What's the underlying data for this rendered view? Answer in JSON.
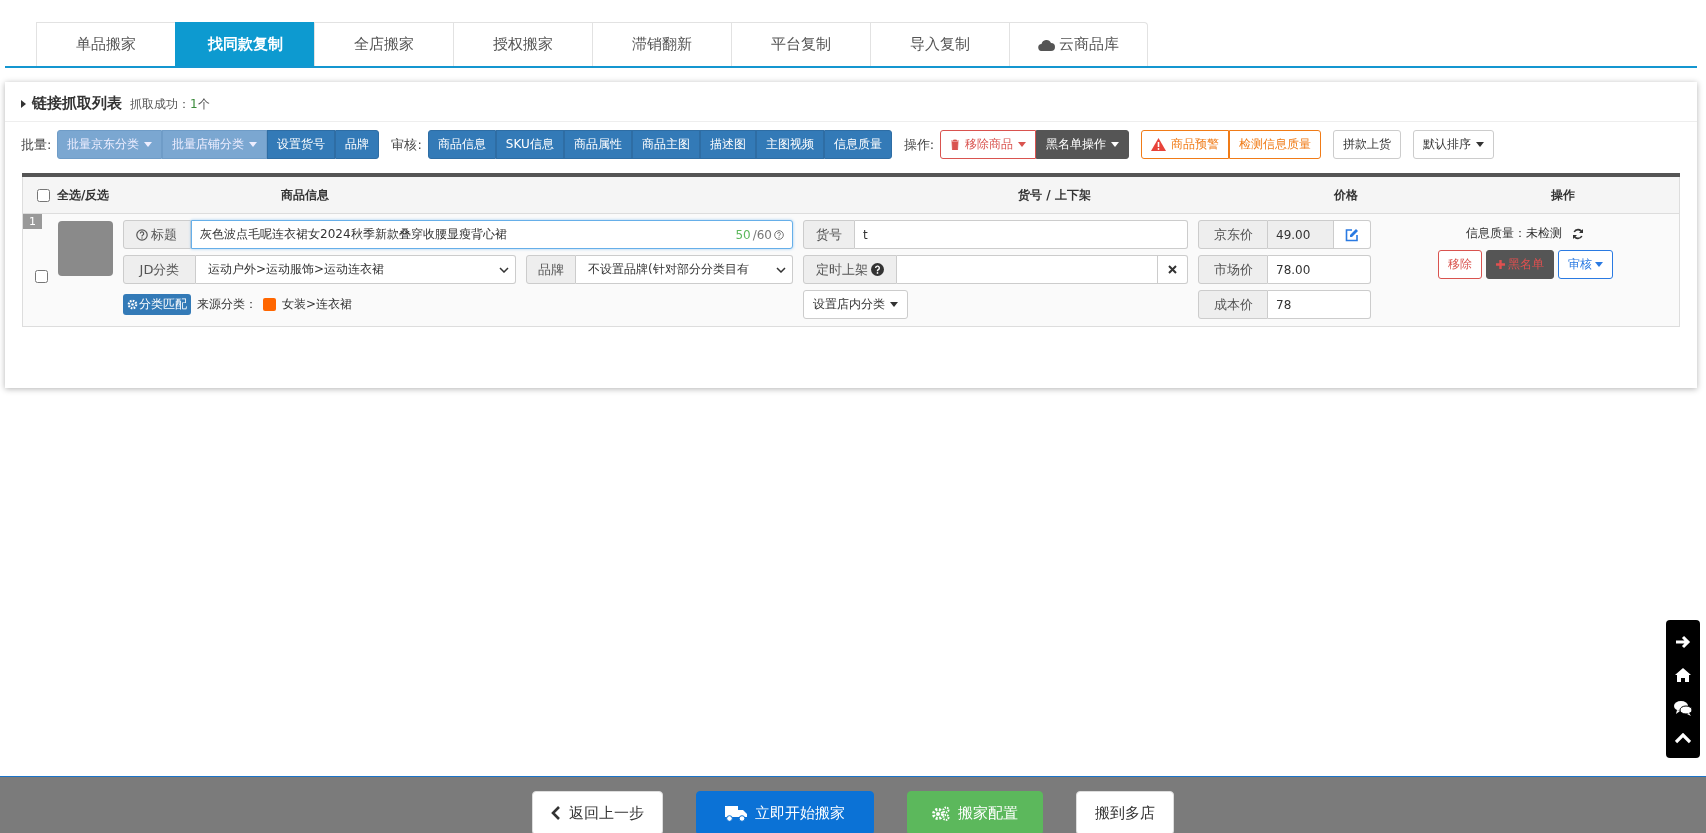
{
  "tabs": [
    {
      "label": "单品搬家",
      "selected": false,
      "kind": "plain"
    },
    {
      "label": "找同款复制",
      "selected": true,
      "kind": "plain"
    },
    {
      "label": "全店搬家",
      "selected": false,
      "kind": "plain"
    },
    {
      "label": "授权搬家",
      "selected": false,
      "kind": "plain"
    },
    {
      "label": "滞销翻新",
      "selected": false,
      "kind": "plain"
    },
    {
      "label": "平台复制",
      "selected": false,
      "kind": "plain"
    },
    {
      "label": "导入复制",
      "selected": false,
      "kind": "plain"
    },
    {
      "label": "云商品库",
      "selected": false,
      "kind": "cloud"
    }
  ],
  "panel": {
    "title": "链接抓取列表",
    "success_label": "抓取成功：",
    "success_count": "1",
    "success_unit": "个"
  },
  "toolbar": [
    {
      "label": "批量:",
      "buttons": [
        {
          "label": "批量京东分类",
          "kind": "primary",
          "disabled": true,
          "caret": true
        },
        {
          "label": "批量店铺分类",
          "kind": "primary",
          "disabled": true,
          "caret": true
        },
        {
          "label": "设置货号",
          "kind": "primary",
          "disabled": false,
          "caret": false
        },
        {
          "label": "品牌",
          "kind": "primary",
          "disabled": false,
          "caret": false
        }
      ]
    },
    {
      "label": "审核:",
      "buttons": [
        {
          "label": "商品信息",
          "kind": "primary",
          "disabled": false,
          "caret": false
        },
        {
          "label": "SKU信息",
          "kind": "primary",
          "disabled": false,
          "caret": false
        },
        {
          "label": "商品属性",
          "kind": "primary",
          "disabled": false,
          "caret": false
        },
        {
          "label": "商品主图",
          "kind": "primary",
          "disabled": false,
          "caret": false
        },
        {
          "label": "描述图",
          "kind": "primary",
          "disabled": false,
          "caret": false
        },
        {
          "label": "主图视频",
          "kind": "primary",
          "disabled": false,
          "caret": false
        },
        {
          "label": "信息质量",
          "kind": "primary",
          "disabled": false,
          "caret": false
        }
      ]
    },
    {
      "label": "操作:",
      "buttons": [
        {
          "label": "移除商品",
          "kind": "danger",
          "disabled": false,
          "caret": true
        },
        {
          "label": "黑名单操作",
          "kind": "dark",
          "disabled": false,
          "caret": true
        }
      ]
    },
    {
      "buttons": [
        {
          "label": "商品预警",
          "kind": "alert",
          "disabled": false,
          "caret": false
        },
        {
          "label": "检测信息质量",
          "kind": "warning",
          "disabled": false,
          "caret": false
        }
      ]
    },
    {
      "buttons": [
        {
          "label": "拼款上货",
          "kind": "default",
          "disabled": false,
          "caret": false
        }
      ]
    },
    {
      "buttons": [
        {
          "label": "默认排序",
          "kind": "default",
          "disabled": false,
          "caret": true
        }
      ]
    }
  ],
  "table": {
    "select_all": {
      "label": "全选/反选",
      "checked": false
    },
    "columns": [
      "商品信息",
      "货号 / 上下架",
      "价格",
      "操作"
    ],
    "rows": [
      {
        "index": "1",
        "checked": false,
        "title_label": "标题",
        "title": "灰色波点毛呢连衣裙女2024秋季新款叠穿收腰显瘦背心裙",
        "title_count": "50",
        "title_max": "/60",
        "category_label": "JD分类",
        "category": "运动户外>运动服饰>运动连衣裙",
        "brand_label": "品牌",
        "brand": "不设置品牌(针对部分分类目有",
        "match_button": "分类匹配",
        "source_label": "来源分类：",
        "source": "女装>连衣裙",
        "sku_label": "货号",
        "sku": "t",
        "schedule_label": "定时上架",
        "shop_category_button": "设置店内分类",
        "prices": [
          {
            "label": "京东价",
            "value": "49.00",
            "kind": "jd"
          },
          {
            "label": "市场价",
            "value": "78.00",
            "kind": "plain"
          },
          {
            "label": "成本价",
            "value": "78",
            "kind": "plain"
          }
        ],
        "quality_label": "信息质量：",
        "quality": "未检测",
        "actions": [
          {
            "label": "移除",
            "kind": "remove"
          },
          {
            "label": "黑名单",
            "kind": "blacklist"
          },
          {
            "label": "审核",
            "kind": "review"
          }
        ]
      }
    ]
  },
  "footer": [
    {
      "label": "返回上一步",
      "kind": "back"
    },
    {
      "label": "立即开始搬家",
      "kind": "start"
    },
    {
      "label": "搬家配置",
      "kind": "config"
    },
    {
      "label": "搬到多店",
      "kind": "plain"
    }
  ]
}
